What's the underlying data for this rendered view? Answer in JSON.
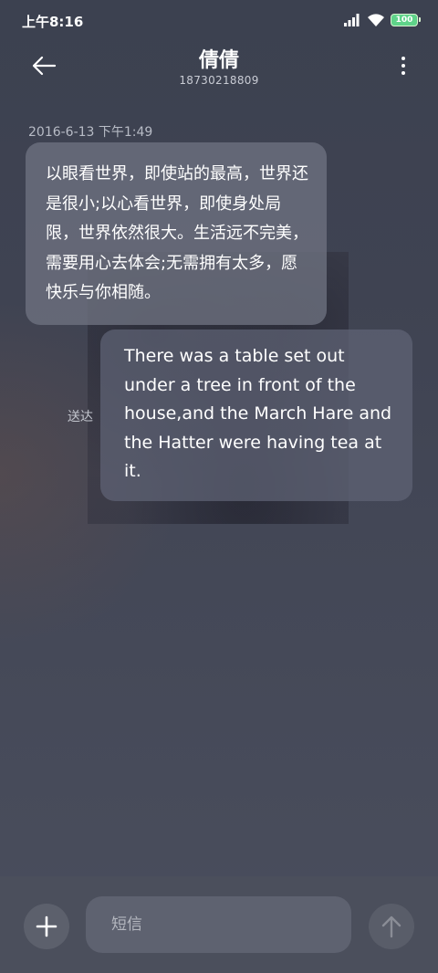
{
  "status_bar": {
    "time": "上午8:16",
    "battery_level": "100",
    "icons": [
      "signal-icon",
      "wifi-icon",
      "battery-icon"
    ]
  },
  "header": {
    "contact_name": "倩倩",
    "phone_number": "18730218809",
    "back_icon": "arrow-left-icon",
    "menu_icon": "more-vertical-icon"
  },
  "messages": [
    {
      "direction": "incoming",
      "timestamp": "2016-6-13 下午1:49",
      "text": "以眼看世界，即使站的最高，世界还是很小;以心看世界，即使身处局限，世界依然很大。生活远不完美，需要用心去体会;无需拥有太多，愿快乐与你相随。"
    },
    {
      "direction": "outgoing",
      "status": "送达",
      "text": "There was a table set out under a tree in front of the house,and the March Hare and the Hatter were having tea at it."
    }
  ],
  "input_bar": {
    "placeholder": "短信",
    "add_icon": "plus-icon",
    "send_icon": "arrow-up-icon"
  },
  "colors": {
    "background": "#3f4352",
    "incoming_bubble": "#6e7280",
    "outgoing_bubble": "#5f6476",
    "input_bar": "#4b4f5c",
    "battery": "#5fd38a"
  }
}
